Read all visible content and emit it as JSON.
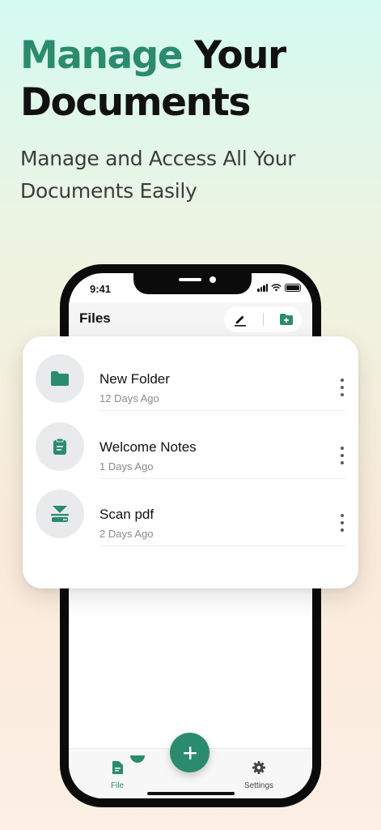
{
  "hero": {
    "title_accent": "Manage",
    "title_rest": " Your Documents",
    "subtitle": "Manage and Access All Your Documents Easily"
  },
  "status_bar": {
    "time": "9:41"
  },
  "app": {
    "title": "Files",
    "actions": [
      "edit-icon",
      "new-folder-icon"
    ]
  },
  "files": [
    {
      "name": "New Folder",
      "date": "12 Days Ago",
      "icon": "folder-icon"
    },
    {
      "name": "Welcome Notes",
      "date": "1 Days Ago",
      "icon": "clipboard-icon"
    },
    {
      "name": "Scan pdf",
      "date": "2 Days Ago",
      "icon": "scanner-icon"
    }
  ],
  "tabbar": {
    "file_label": "File",
    "settings_label": "Settings",
    "fab_icon": "plus-icon"
  },
  "colors": {
    "accent": "#2a8c6c",
    "text": "#111111",
    "muted": "#8a8a8a"
  }
}
